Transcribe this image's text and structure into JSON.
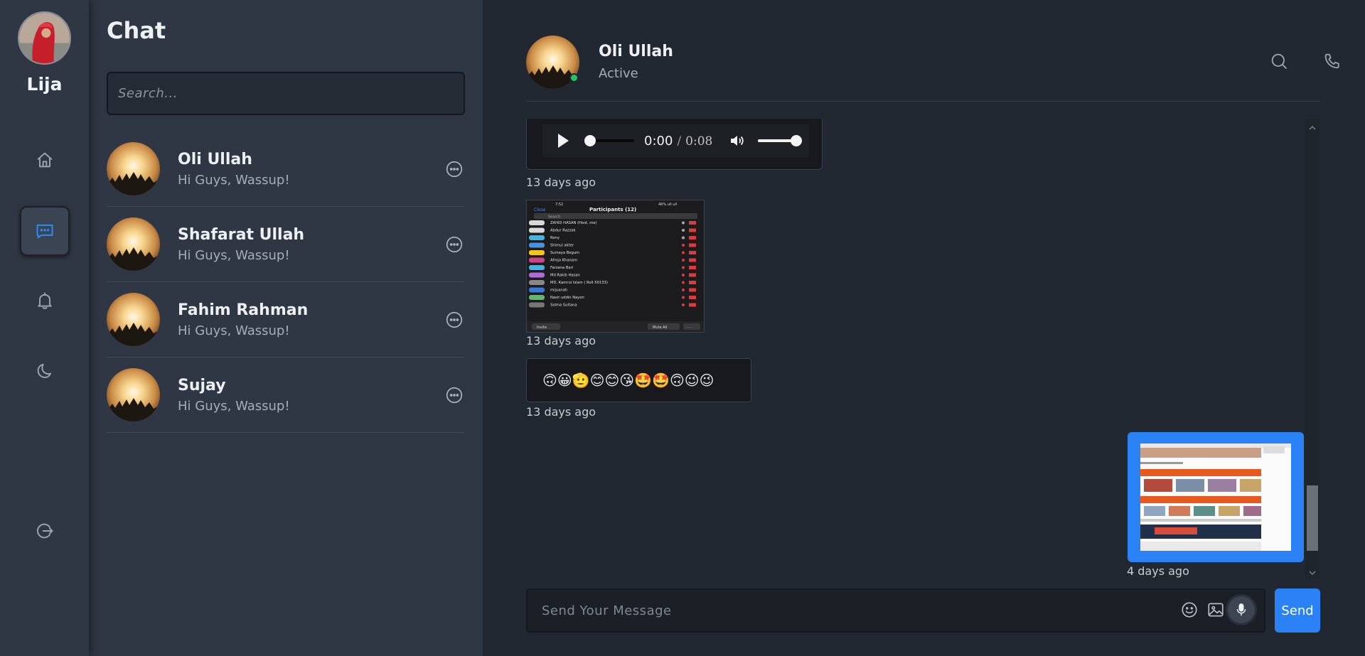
{
  "user": {
    "name": "Lija"
  },
  "nav": {
    "items": [
      {
        "name": "home",
        "icon": "home-icon"
      },
      {
        "name": "chat",
        "icon": "chat-icon",
        "active": true
      },
      {
        "name": "notifications",
        "icon": "bell-icon"
      },
      {
        "name": "theme",
        "icon": "moon-icon"
      },
      {
        "name": "logout",
        "icon": "logout-icon"
      }
    ]
  },
  "panel": {
    "title": "Chat",
    "search_placeholder": "Search..."
  },
  "contacts": [
    {
      "name": "Oli Ullah",
      "message": "Hi Guys, Wassup!"
    },
    {
      "name": "Shafarat Ullah",
      "message": "Hi Guys, Wassup!"
    },
    {
      "name": "Fahim Rahman",
      "message": "Hi Guys, Wassup!"
    },
    {
      "name": "Sujay",
      "message": "Hi Guys, Wassup!"
    }
  ],
  "conversation": {
    "name": "Oli Ullah",
    "status": "Active",
    "audio": {
      "current": "0:00",
      "separator": "/",
      "duration": "0:08"
    },
    "messages": [
      {
        "type": "audio",
        "timestamp": "13 days ago"
      },
      {
        "type": "image",
        "timestamp": "13 days ago",
        "screenshot": {
          "status_time": "7:52",
          "status_right": "46% ull ull",
          "close": "Close",
          "title": "Participants (12)",
          "search": "Search",
          "rows": [
            "ZAHID HASAN (Host, me)",
            "Abdur Razzak",
            "Rony",
            "Shimul akter",
            "Sumaya Begum",
            "Afroja Khanam",
            "Farzana Bari",
            "Md Rakib Hasan",
            "MD. Kamrul Islam ( Roll-50133)",
            "mijuanah",
            "Nasir uddin Nayon",
            "Salma Sultana"
          ],
          "invite": "Invite",
          "mute_all": "Mute All",
          "more": "· · ·"
        }
      },
      {
        "type": "emoji",
        "content": "🙃😀🫡😊😊😘🤩🤩🙃😉😉",
        "timestamp": "13 days ago"
      },
      {
        "type": "image",
        "sent": true,
        "timestamp": "4 days ago"
      }
    ]
  },
  "composer": {
    "placeholder": "Send Your Message",
    "send_label": "Send"
  },
  "colors": {
    "accent": "#2b82f4",
    "online": "#22c55e",
    "background": "#222831",
    "panel": "#2f3744"
  }
}
